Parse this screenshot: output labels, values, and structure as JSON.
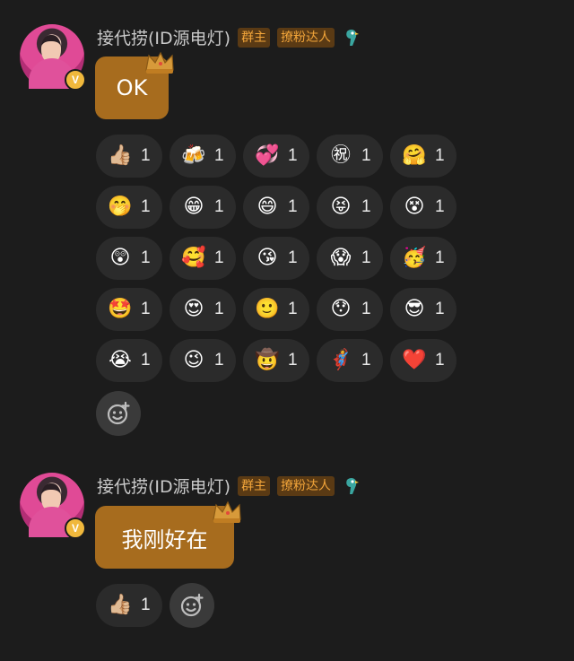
{
  "messages": [
    {
      "sender": "接代捞(ID源电灯)",
      "tags": [
        "群主",
        "撩粉达人"
      ],
      "text": "OK",
      "reactions": [
        {
          "icon": "👍🏼",
          "count": "1"
        },
        {
          "icon": "🍻",
          "count": "1"
        },
        {
          "icon": "💞",
          "count": "1"
        },
        {
          "icon": "㊗",
          "count": "1"
        },
        {
          "icon": "🤗",
          "count": "1"
        },
        {
          "icon": "🤭",
          "count": "1"
        },
        {
          "icon": "😁",
          "count": "1"
        },
        {
          "icon": "😄",
          "count": "1"
        },
        {
          "icon": "😝",
          "count": "1"
        },
        {
          "icon": "😵",
          "count": "1"
        },
        {
          "icon": "😲",
          "count": "1"
        },
        {
          "icon": "🥰",
          "count": "1"
        },
        {
          "icon": "😘",
          "count": "1"
        },
        {
          "icon": "😱",
          "count": "1"
        },
        {
          "icon": "🥳",
          "count": "1"
        },
        {
          "icon": "🤩",
          "count": "1"
        },
        {
          "icon": "😍",
          "count": "1"
        },
        {
          "icon": "🙂",
          "count": "1"
        },
        {
          "icon": "😯",
          "count": "1"
        },
        {
          "icon": "😎",
          "count": "1"
        },
        {
          "icon": "😭",
          "count": "1"
        },
        {
          "icon": "😉",
          "count": "1"
        },
        {
          "icon": "🤠",
          "count": "1"
        },
        {
          "icon": "🦸",
          "count": "1"
        },
        {
          "icon": "❤️",
          "count": "1"
        }
      ]
    },
    {
      "sender": "接代捞(ID源电灯)",
      "tags": [
        "群主",
        "撩粉达人"
      ],
      "text": "我刚好在",
      "reactions": [
        {
          "icon": "👍🏼",
          "count": "1"
        }
      ]
    }
  ],
  "badge": {
    "verified": "V"
  },
  "colors": {
    "background": "#1c1c1c",
    "bubble": "#a76c1e",
    "tag_text": "#f2a53a",
    "pill": "#2b2b2b"
  }
}
